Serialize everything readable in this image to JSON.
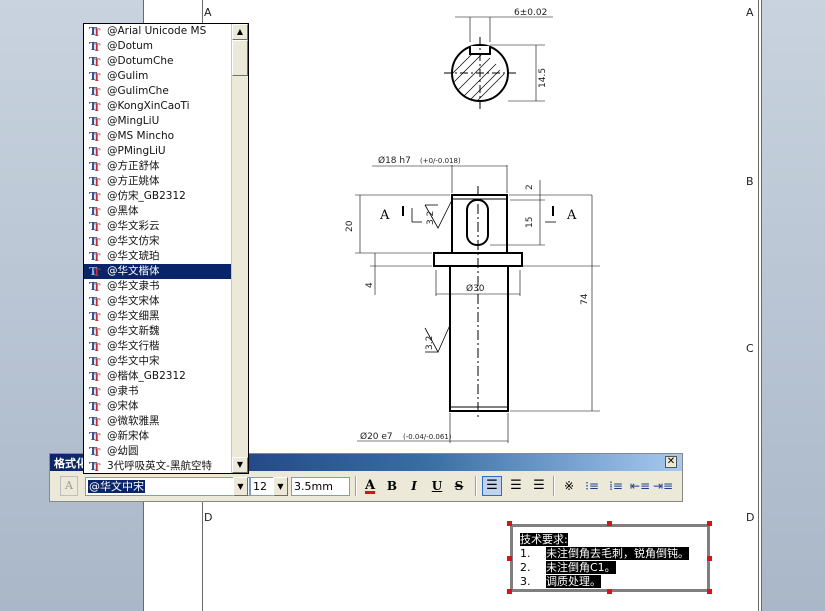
{
  "zones": {
    "left": [
      "A",
      "D"
    ],
    "right": [
      "A",
      "B",
      "C",
      "D"
    ]
  },
  "drawing": {
    "dims": {
      "keyway_width": "6±0.02",
      "keyway_depth": "14.5",
      "diameter_top": "Ø18 h7",
      "diameter_top_tol": "(+0/-0.018)",
      "height_20": "20",
      "height_2": "2",
      "height_15": "15",
      "height_4": "4",
      "length_74": "74",
      "flange_diameter": "Ø30",
      "diameter_bottom": "Ø20 e7",
      "diameter_bottom_tol": "(-0.04/-0.061)",
      "roughness_1": "3.2",
      "roughness_2": "3.2",
      "section_left": "A",
      "section_right": "A"
    }
  },
  "font_list": {
    "selected_index": 16,
    "items": [
      "@Arial Unicode MS",
      "@Dotum",
      "@DotumChe",
      "@Gulim",
      "@GulimChe",
      "@KongXinCaoTi",
      "@MingLiU",
      "@MS Mincho",
      "@PMingLiU",
      "@方正舒体",
      "@方正姚体",
      "@仿宋_GB2312",
      "@黑体",
      "@华文彩云",
      "@华文仿宋",
      "@华文琥珀",
      "@华文楷体",
      "@华文隶书",
      "@华文宋体",
      "@华文细黑",
      "@华文新魏",
      "@华文行楷",
      "@华文中宋",
      "@楷体_GB2312",
      "@隶书",
      "@宋体",
      "@微软雅黑",
      "@新宋体",
      "@幼圆",
      "3代呼吸英文-黑航空特"
    ]
  },
  "toolbar": {
    "title": "格式化",
    "font_value": "@华文中宋",
    "size_value": "12",
    "height_value": "3.5mm",
    "bold_label": "B",
    "italic_label": "I",
    "underline_label": "U",
    "strike_label": "S",
    "close_label": "✕",
    "color_icon": "text-color-icon",
    "icons": [
      "text-style-icon",
      "text-color-icon",
      "bold-icon",
      "italic-icon",
      "underline-icon",
      "strikethrough-icon",
      "align-left-icon",
      "align-center-icon",
      "align-right-icon",
      "symbol-icon",
      "bullets-icon",
      "numbering-icon",
      "indent-decrease-icon",
      "indent-increase-icon"
    ]
  },
  "note": {
    "title": "技术要求:",
    "lines": [
      {
        "num": "1.",
        "text": "未注倒角去毛刺，锐角倒钝。"
      },
      {
        "num": "2.",
        "text": "未注倒角C1。"
      },
      {
        "num": "3.",
        "text": "调质处理。"
      }
    ]
  },
  "colors": {
    "selection": "#0a246a",
    "handle": "#d01818",
    "title_bar": "#0a246a"
  }
}
